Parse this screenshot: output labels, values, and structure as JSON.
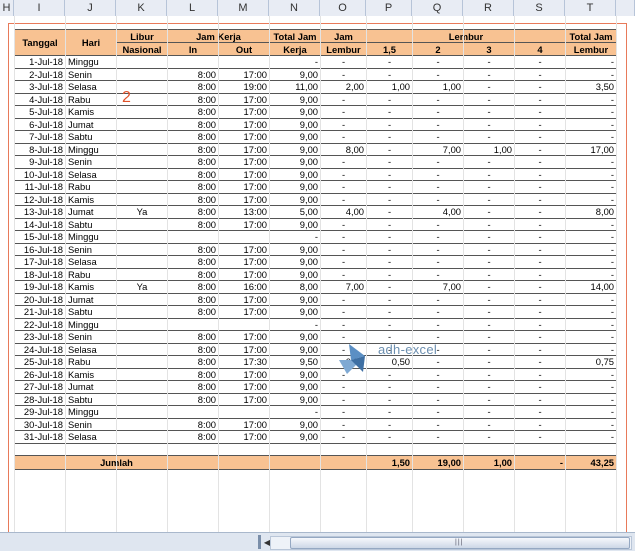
{
  "columns": [
    "H",
    "I",
    "J",
    "K",
    "L",
    "M",
    "N",
    "O",
    "P",
    "Q",
    "R",
    "S",
    "T"
  ],
  "header": {
    "tanggal": "Tanggal",
    "hari": "Hari",
    "libur1": "Libur",
    "libur2": "Nasional",
    "jam_kerja": "Jam Kerja",
    "in": "In",
    "out": "Out",
    "total1": "Total Jam",
    "total2": "Kerja",
    "jamlembur1": "Jam",
    "jamlembur2": "Lembur",
    "lembur": "Lembur",
    "l15": "1,5",
    "l2": "2",
    "l3": "3",
    "l4": "4",
    "totallembur1": "Total Jam",
    "totallembur2": "Lembur"
  },
  "rows": [
    [
      "1-Jul-18",
      "Minggu",
      "",
      "",
      "",
      "-",
      "-",
      "-",
      "-",
      "-",
      "-",
      "-"
    ],
    [
      "2-Jul-18",
      "Senin",
      "",
      "8:00",
      "17:00",
      "9,00",
      "-",
      "-",
      "-",
      "-",
      "-",
      "-"
    ],
    [
      "3-Jul-18",
      "Selasa",
      "",
      "8:00",
      "19:00",
      "11,00",
      "2,00",
      "1,00",
      "1,00",
      "-",
      "-",
      "3,50"
    ],
    [
      "4-Jul-18",
      "Rabu",
      "",
      "8:00",
      "17:00",
      "9,00",
      "-",
      "-",
      "-",
      "-",
      "-",
      "-"
    ],
    [
      "5-Jul-18",
      "Kamis",
      "",
      "8:00",
      "17:00",
      "9,00",
      "-",
      "-",
      "-",
      "-",
      "-",
      "-"
    ],
    [
      "6-Jul-18",
      "Jumat",
      "",
      "8:00",
      "17:00",
      "9,00",
      "-",
      "-",
      "-",
      "-",
      "-",
      "-"
    ],
    [
      "7-Jul-18",
      "Sabtu",
      "",
      "8:00",
      "17:00",
      "9,00",
      "-",
      "-",
      "-",
      "-",
      "-",
      "-"
    ],
    [
      "8-Jul-18",
      "Minggu",
      "",
      "8:00",
      "17:00",
      "9,00",
      "8,00",
      "-",
      "7,00",
      "1,00",
      "-",
      "17,00"
    ],
    [
      "9-Jul-18",
      "Senin",
      "",
      "8:00",
      "17:00",
      "9,00",
      "-",
      "-",
      "-",
      "-",
      "-",
      "-"
    ],
    [
      "10-Jul-18",
      "Selasa",
      "",
      "8:00",
      "17:00",
      "9,00",
      "-",
      "-",
      "-",
      "-",
      "-",
      "-"
    ],
    [
      "11-Jul-18",
      "Rabu",
      "",
      "8:00",
      "17:00",
      "9,00",
      "-",
      "-",
      "-",
      "-",
      "-",
      "-"
    ],
    [
      "12-Jul-18",
      "Kamis",
      "",
      "8:00",
      "17:00",
      "9,00",
      "-",
      "-",
      "-",
      "-",
      "-",
      "-"
    ],
    [
      "13-Jul-18",
      "Jumat",
      "Ya",
      "8:00",
      "13:00",
      "5,00",
      "4,00",
      "-",
      "4,00",
      "-",
      "-",
      "8,00"
    ],
    [
      "14-Jul-18",
      "Sabtu",
      "",
      "8:00",
      "17:00",
      "9,00",
      "-",
      "-",
      "-",
      "-",
      "-",
      "-"
    ],
    [
      "15-Jul-18",
      "Minggu",
      "",
      "",
      "",
      "-",
      "-",
      "-",
      "-",
      "-",
      "-",
      "-"
    ],
    [
      "16-Jul-18",
      "Senin",
      "",
      "8:00",
      "17:00",
      "9,00",
      "-",
      "-",
      "-",
      "-",
      "-",
      "-"
    ],
    [
      "17-Jul-18",
      "Selasa",
      "",
      "8:00",
      "17:00",
      "9,00",
      "-",
      "-",
      "-",
      "-",
      "-",
      "-"
    ],
    [
      "18-Jul-18",
      "Rabu",
      "",
      "8:00",
      "17:00",
      "9,00",
      "-",
      "-",
      "-",
      "-",
      "-",
      "-"
    ],
    [
      "19-Jul-18",
      "Kamis",
      "Ya",
      "8:00",
      "16:00",
      "8,00",
      "7,00",
      "-",
      "7,00",
      "-",
      "-",
      "14,00"
    ],
    [
      "20-Jul-18",
      "Jumat",
      "",
      "8:00",
      "17:00",
      "9,00",
      "-",
      "-",
      "-",
      "-",
      "-",
      "-"
    ],
    [
      "21-Jul-18",
      "Sabtu",
      "",
      "8:00",
      "17:00",
      "9,00",
      "-",
      "-",
      "-",
      "-",
      "-",
      "-"
    ],
    [
      "22-Jul-18",
      "Minggu",
      "",
      "",
      "",
      "-",
      "-",
      "-",
      "-",
      "-",
      "-",
      "-"
    ],
    [
      "23-Jul-18",
      "Senin",
      "",
      "8:00",
      "17:00",
      "9,00",
      "-",
      "-",
      "-",
      "-",
      "-",
      "-"
    ],
    [
      "24-Jul-18",
      "Selasa",
      "",
      "8:00",
      "17:00",
      "9,00",
      "-",
      "-",
      "-",
      "-",
      "-",
      "-"
    ],
    [
      "25-Jul-18",
      "Rabu",
      "",
      "8:00",
      "17:30",
      "9,50",
      "0,50",
      "0,50",
      "-",
      "-",
      "-",
      "0,75"
    ],
    [
      "26-Jul-18",
      "Kamis",
      "",
      "8:00",
      "17:00",
      "9,00",
      "-",
      "-",
      "-",
      "-",
      "-",
      "-"
    ],
    [
      "27-Jul-18",
      "Jumat",
      "",
      "8:00",
      "17:00",
      "9,00",
      "-",
      "-",
      "-",
      "-",
      "-",
      "-"
    ],
    [
      "28-Jul-18",
      "Sabtu",
      "",
      "8:00",
      "17:00",
      "9,00",
      "-",
      "-",
      "-",
      "-",
      "-",
      "-"
    ],
    [
      "29-Jul-18",
      "Minggu",
      "",
      "",
      "",
      "-",
      "-",
      "-",
      "-",
      "-",
      "-",
      "-"
    ],
    [
      "30-Jul-18",
      "Senin",
      "",
      "8:00",
      "17:00",
      "9,00",
      "-",
      "-",
      "-",
      "-",
      "-",
      "-"
    ],
    [
      "31-Jul-18",
      "Selasa",
      "",
      "8:00",
      "17:00",
      "9,00",
      "-",
      "-",
      "-",
      "-",
      "-",
      "-"
    ],
    [
      "",
      "",
      "",
      "",
      "",
      "",
      "",
      "",
      "",
      "",
      "",
      ""
    ]
  ],
  "footer": {
    "label": "Jumlah",
    "l15": "1,50",
    "l2": "19,00",
    "l3": "1,00",
    "l4": "-",
    "total": "43,25"
  },
  "annotation": "2",
  "watermark": "adh-excel",
  "colors": {
    "header_fill": "#f8c292",
    "frame": "#e87a5a",
    "annotation": "#e0522a"
  }
}
